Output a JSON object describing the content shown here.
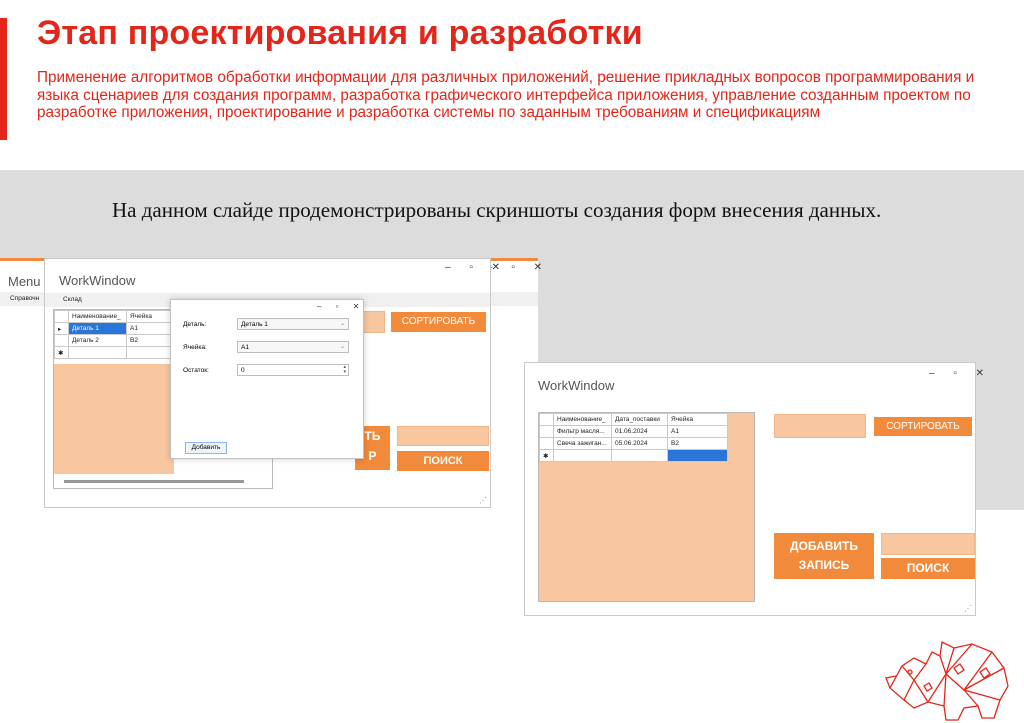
{
  "slide": {
    "title": "Этап проектирования и разработки",
    "subtitle": "Применение алгоритмов обработки информации для различных приложений, решение прикладных вопросов программирования и языка сценариев для создания программ, разработка графического интерфейса приложения, управление созданным проектом по разработке приложения, проектирование и разработка системы по заданным требованиям и спецификациям",
    "text": "На данном слайде продемонстрированы скриншоты создания форм внесения данных."
  },
  "colors": {
    "accent": "#e32619",
    "orange": "#f28a3b",
    "peach": "#f8c69f"
  },
  "menu_window": {
    "title": "Menu",
    "menu_items": [
      "Справочн",
      "Склад"
    ],
    "controls": "– ▫ ✕"
  },
  "work_window_back": {
    "title": "WorkWindow",
    "controls": "– ▫ ✕",
    "grid_header": [
      "Наименование_",
      "Ячейка"
    ],
    "grid_rows": [
      [
        "Деталь 1",
        "A1"
      ],
      [
        "Деталь 2",
        "B2"
      ]
    ],
    "sort_button": "СОРТИРОВАТЬ",
    "add_button_partial": "ТЬ",
    "add_button_partial2": "Р",
    "search_button": "ПОИСК"
  },
  "dialog": {
    "controls": "– ▫ ✕",
    "detail_label": "Деталь:",
    "detail_value": "Деталь 1",
    "cell_label": "Ячейка:",
    "cell_value": "A1",
    "rest_label": "Остаток:",
    "rest_value": "0",
    "add_button": "Добавить"
  },
  "work_window_front": {
    "title": "WorkWindow",
    "controls": "– ▫ ✕",
    "grid_header": [
      "Наименование_",
      "Дата_поставки",
      "Ячейка"
    ],
    "grid_rows": [
      [
        "Фильтр масля...",
        "01.06.2024",
        "A1"
      ],
      [
        "Свеча зажиган...",
        "05.06.2024",
        "B2"
      ]
    ],
    "sort_button": "СОРТИРОВАТЬ",
    "add_button": "ДОБАВИТЬ ЗАПИСЬ",
    "search_button": "ПОИСК"
  }
}
